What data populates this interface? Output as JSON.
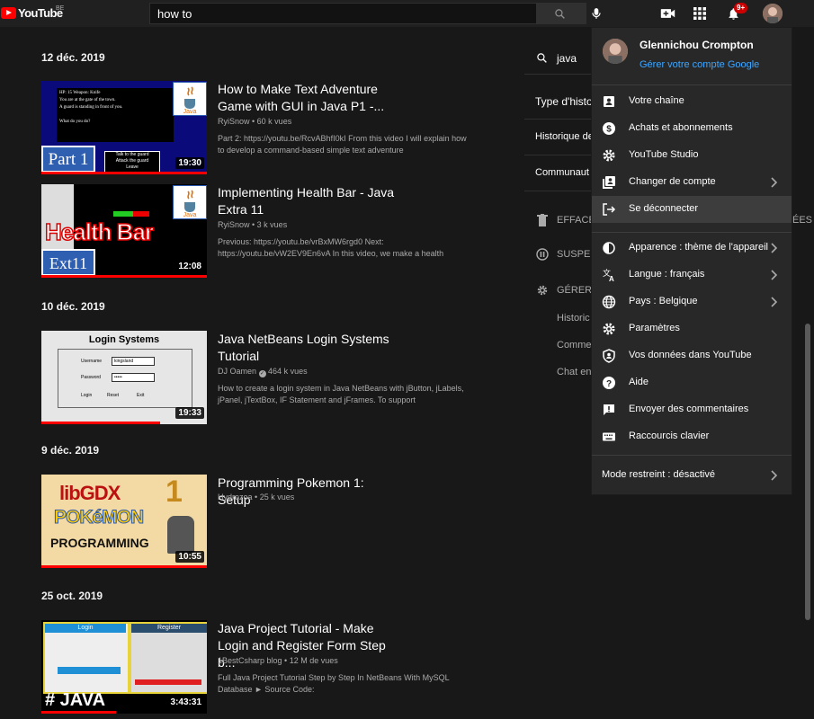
{
  "topbar": {
    "logo_text": "YouTube",
    "country_code": "BE",
    "search_value": "how to",
    "notifications_count": "9+"
  },
  "main": {
    "groups": [
      {
        "date": "12 déc. 2019"
      },
      {
        "date": "10 déc. 2019"
      },
      {
        "date": "9 déc. 2019"
      },
      {
        "date": "25 oct. 2019"
      }
    ],
    "videos": [
      {
        "title": "How to Make Text Adventure Game with GUI in Java P1 -...",
        "channel": "RyiSnow",
        "views": "60 k vues",
        "description": "Part 2: https://youtu.be/RcvABhfI0kI From this video I will explain how to develop a command-based simple text adventure",
        "duration": "19:30",
        "progress": 1.0,
        "thumb_label": "Part 1"
      },
      {
        "title": "Implementing Health Bar - Java Extra 11",
        "channel": "RyiSnow",
        "views": "3 k vues",
        "description": "Previous: https://youtu.be/vrBxMW6rgd0 Next: https://youtu.be/vW2EV9En6vA In this video, we make a health",
        "duration": "12:08",
        "progress": 1.0,
        "thumb_label": "Ext11",
        "thumb_big": "Health Bar"
      },
      {
        "title": "Java NetBeans Login Systems Tutorial",
        "channel": "DJ Oamen",
        "views": "464 k vues",
        "description": "How to create a login system in Java NetBeans with jButton, jLabels, jPanel, jTextBox, IF Statement and jFrames. To support",
        "duration": "19:33",
        "progress": 0.72,
        "thumb_label": "Login Systems",
        "thumb_username_label": "Username",
        "thumb_username_value": "kingsland",
        "thumb_password_label": "Password",
        "thumb_password_value": "•••••",
        "thumb_buttons": [
          "Login",
          "Reset",
          "Exit"
        ]
      },
      {
        "title": "Programming Pokemon 1: Setup",
        "channel": "Hydrozoa",
        "views": "25 k vues",
        "description": "",
        "duration": "10:55",
        "progress": 1.0,
        "thumb_top": "libGDX",
        "thumb_num": "1",
        "thumb_mid": "POKéMON",
        "thumb_bottom": "PROGRAMMING"
      },
      {
        "title": "Java Project Tutorial - Make Login and Register Form Step b...",
        "channel": "1BestCsharp blog",
        "views": "12 M de vues",
        "description": "Full Java Project Tutorial Step by Step In NetBeans With MySQL Database ► Source Code:",
        "duration": "3:43:31",
        "progress": 0.45,
        "thumb_login": "Login",
        "thumb_register": "Register",
        "thumb_tag": "# JAVA"
      }
    ]
  },
  "right_panel": {
    "search_value": "java",
    "type_label": "Type d'histo",
    "history_label": "Historique de",
    "community_label": "Communaut",
    "clear_label": "EFFACE",
    "clear_trail": "ÉES",
    "pause_label": "SUSPEN",
    "manage_label": "GÉRER",
    "sub_items": [
      "Historic",
      "Comme",
      "Chat en"
    ]
  },
  "menu": {
    "user_name": "Glennichou Crompton",
    "manage_account": "Gérer votre compte Google",
    "items_a": [
      {
        "label": "Votre chaîne",
        "icon": "account-box-icon",
        "chevron": false
      },
      {
        "label": "Achats et abonnements",
        "icon": "dollar-circle-icon",
        "chevron": false
      },
      {
        "label": "YouTube Studio",
        "icon": "gear-icon",
        "chevron": false
      },
      {
        "label": "Changer de compte",
        "icon": "switch-account-icon",
        "chevron": true
      },
      {
        "label": "Se déconnecter",
        "icon": "logout-icon",
        "chevron": false
      }
    ],
    "items_b": [
      {
        "label": "Apparence : thème de l'appareil",
        "icon": "appearance-icon",
        "chevron": true
      },
      {
        "label": "Langue : français",
        "icon": "translate-icon",
        "chevron": true
      },
      {
        "label": "Pays : Belgique",
        "icon": "globe-icon",
        "chevron": true
      },
      {
        "label": "Paramètres",
        "icon": "gear-icon",
        "chevron": false
      },
      {
        "label": "Vos données dans YouTube",
        "icon": "shield-person-icon",
        "chevron": false
      },
      {
        "label": "Aide",
        "icon": "help-icon",
        "chevron": false
      },
      {
        "label": "Envoyer des commentaires",
        "icon": "feedback-icon",
        "chevron": false
      },
      {
        "label": "Raccourcis clavier",
        "icon": "keyboard-icon",
        "chevron": false
      }
    ],
    "restricted_label": "Mode restreint : désactivé"
  },
  "colors": {
    "brand_red": "#ff0000",
    "link_blue": "#3ea6ff",
    "menu_bg": "#282828",
    "page_bg": "#181818"
  }
}
